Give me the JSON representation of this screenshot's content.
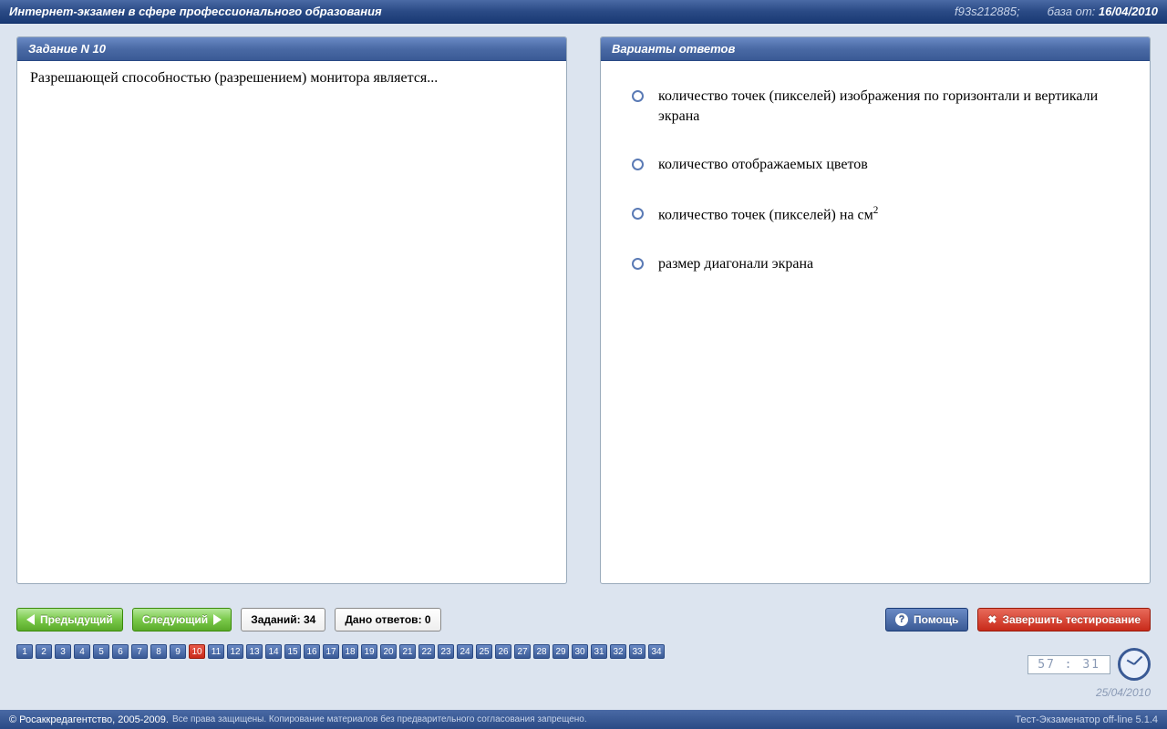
{
  "titlebar": {
    "title": "Интернет-экзамен в сфере профессионального образования",
    "session": "f93s212885;",
    "base_label": "база от:",
    "base_date": "16/04/2010"
  },
  "question_panel": {
    "header": "Задание N 10",
    "text": "Разрешающей способностью (разрешением) монитора является..."
  },
  "answers_panel": {
    "header": "Варианты ответов",
    "items": [
      "количество точек (пикселей) изображения по горизонтали и вертикали экрана",
      "количество отображаемых цветов",
      "количество точек (пикселей) на см",
      "размер диагонали экрана"
    ]
  },
  "controls": {
    "prev": "Предыдущий",
    "next": "Следующий",
    "total": "Заданий: 34",
    "answered": "Дано ответов: 0",
    "help": "Помощь",
    "finish": "Завершить тестирование"
  },
  "nav": {
    "count": 34,
    "current": 10
  },
  "clock": {
    "time": "57 : 31",
    "date": "25/04/2010"
  },
  "footer": {
    "copy": "© Росаккредагентство, 2005-2009.",
    "rights": "Все права защищены. Копирование материалов без предварительного согласования запрещено.",
    "version": "Тест-Экзаменатор off-line 5.1.4"
  }
}
